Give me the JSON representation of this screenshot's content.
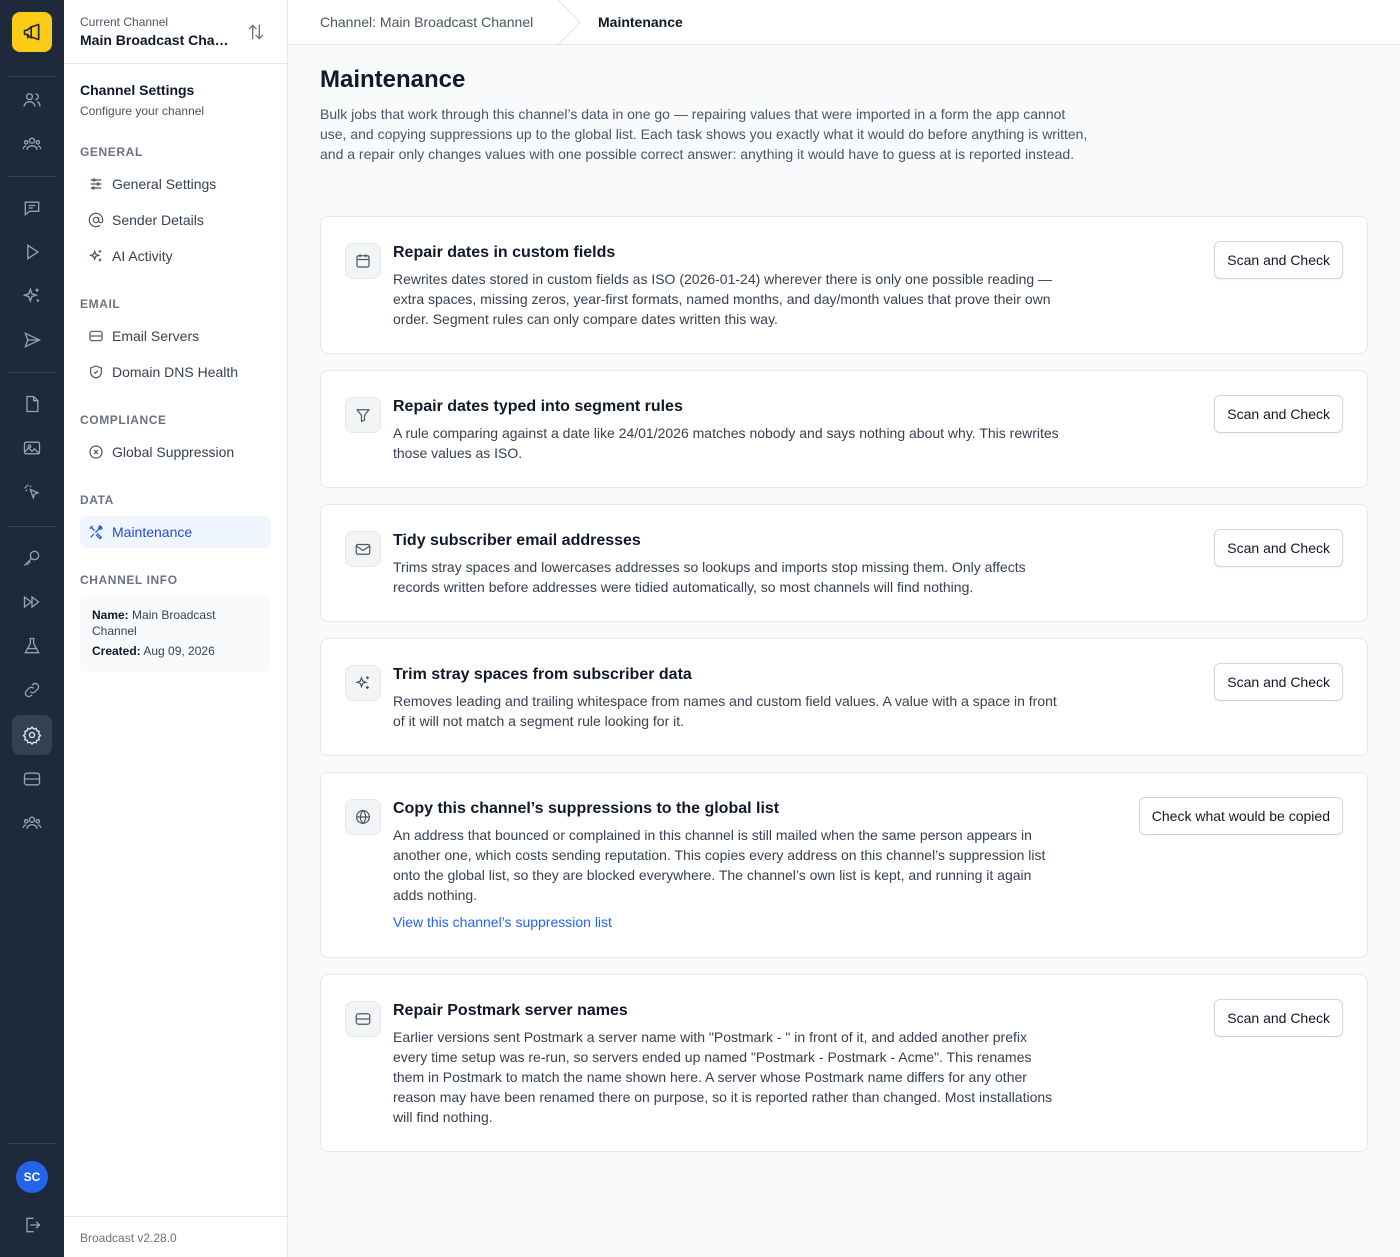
{
  "rail": {
    "logo_icon": "megaphone-icon",
    "avatar_initials": "SC",
    "items": [
      "users-icon",
      "groups-icon",
      "message-icon",
      "play-icon",
      "sparkles-icon",
      "send-icon",
      "file-icon",
      "image-icon",
      "click-icon",
      "key-icon",
      "forward-icon",
      "flask-icon",
      "link-icon",
      "gear-icon",
      "server-icon",
      "team-icon"
    ],
    "active": "gear-icon"
  },
  "sidebar": {
    "current_channel_label": "Current Channel",
    "current_channel_name": "Main Broadcast Channel",
    "title": "Channel Settings",
    "subtitle": "Configure your channel",
    "sections": {
      "general": "GENERAL",
      "email": "EMAIL",
      "compliance": "COMPLIANCE",
      "data": "DATA",
      "channel_info": "CHANNEL INFO"
    },
    "items": {
      "general_settings": "General Settings",
      "sender_details": "Sender Details",
      "ai_activity": "AI Activity",
      "email_servers": "Email Servers",
      "domain_dns_health": "Domain DNS Health",
      "global_suppression": "Global Suppression",
      "maintenance": "Maintenance"
    },
    "info": {
      "name_label": "Name:",
      "name_value": "Main Broadcast Channel",
      "created_label": "Created:",
      "created_value": "Aug 09, 2026"
    },
    "version": "Broadcast v2.28.0"
  },
  "breadcrumb": {
    "parent": "Channel: Main Broadcast Channel",
    "current": "Maintenance"
  },
  "page": {
    "title": "Maintenance",
    "description": "Bulk jobs that work through this channel’s data in one go — repairing values that were imported in a form the app cannot use, and copying suppressions up to the global list. Each task shows you exactly what it would do before anything is written, and a repair only changes values with one possible correct answer: anything it would have to guess at is reported instead."
  },
  "cards": [
    {
      "icon": "calendar-icon",
      "title": "Repair dates in custom fields",
      "description": "Rewrites dates stored in custom fields as ISO (2026-01-24) wherever there is only one possible reading — extra spaces, missing zeros, year-first formats, named months, and day/month values that prove their own order. Segment rules can only compare dates written this way.",
      "button": "Scan and Check"
    },
    {
      "icon": "filter-icon",
      "title": "Repair dates typed into segment rules",
      "description": "A rule comparing against a date like 24/01/2026 matches nobody and says nothing about why. This rewrites those values as ISO.",
      "button": "Scan and Check"
    },
    {
      "icon": "mail-icon",
      "title": "Tidy subscriber email addresses",
      "description": "Trims stray spaces and lowercases addresses so lookups and imports stop missing them. Only affects records written before addresses were tidied automatically, so most channels will find nothing.",
      "button": "Scan and Check"
    },
    {
      "icon": "sparkles-icon",
      "title": "Trim stray spaces from subscriber data",
      "description": "Removes leading and trailing whitespace from names and custom field values. A value with a space in front of it will not match a segment rule looking for it.",
      "button": "Scan and Check"
    },
    {
      "icon": "globe-icon",
      "title": "Copy this channel’s suppressions to the global list",
      "description": "An address that bounced or complained in this channel is still mailed when the same person appears in another one, which costs sending reputation. This copies every address on this channel’s suppression list onto the global list, so they are blocked everywhere. The channel’s own list is kept, and running it again adds nothing.",
      "link": "View this channel’s suppression list",
      "button": "Check what would be copied"
    },
    {
      "icon": "server-icon",
      "title": "Repair Postmark server names",
      "description": "Earlier versions sent Postmark a server name with \"Postmark - \" in front of it, and added another prefix every time setup was re-run, so servers ended up named \"Postmark - Postmark - Acme\". This renames them in Postmark to match the name shown here. A server whose Postmark name differs for any other reason may have been renamed there on purpose, so it is reported rather than changed. Most installations will find nothing.",
      "button": "Scan and Check"
    }
  ]
}
